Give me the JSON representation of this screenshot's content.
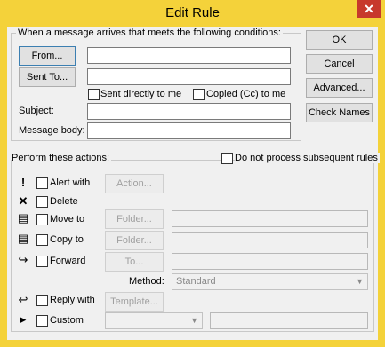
{
  "window": {
    "title": "Edit Rule",
    "close_glyph": "✕"
  },
  "conditions": {
    "legend": "When a message arrives that meets the following conditions:",
    "from_button": "From...",
    "sent_to_button": "Sent To...",
    "sent_directly": "Sent directly to me",
    "copied_cc": "Copied (Cc) to me",
    "subject_label": "Subject:",
    "body_label": "Message body:"
  },
  "side_buttons": {
    "ok": "OK",
    "cancel": "Cancel",
    "advanced": "Advanced...",
    "check_names": "Check Names"
  },
  "actions": {
    "legend": "Perform these actions:",
    "do_not_process": "Do not process subsequent rules",
    "alert_with": "Alert with",
    "action_button": "Action...",
    "delete": "Delete",
    "move_to": "Move to",
    "folder_button": "Folder...",
    "copy_to": "Copy to",
    "folder_button2": "Folder...",
    "forward": "Forward",
    "to_button": "To...",
    "method_label": "Method:",
    "method_value": "Standard",
    "reply_with": "Reply with",
    "template_button": "Template...",
    "custom": "Custom"
  }
}
